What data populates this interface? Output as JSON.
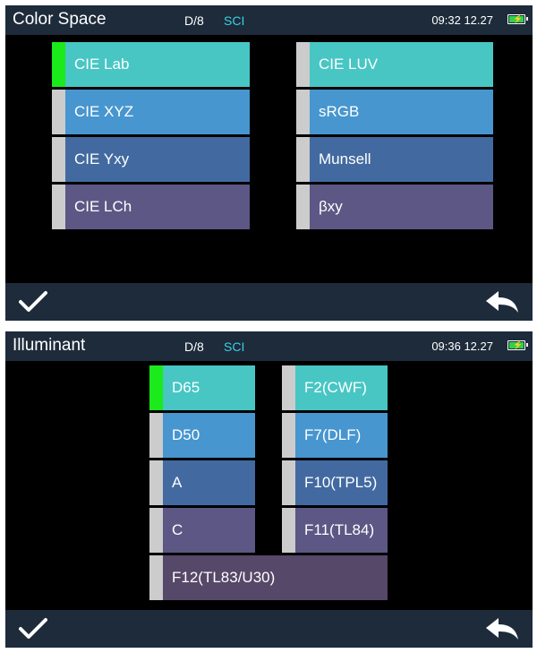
{
  "screens": [
    {
      "title": "Color Space",
      "mode": "D/8",
      "mode2": "SCI",
      "time": "09:32 12.27",
      "options": [
        "CIE Lab",
        "CIE XYZ",
        "CIE Yxy",
        "CIE LCh",
        "CIE LUV",
        "sRGB",
        "Munsell",
        "βxy"
      ],
      "selected": "CIE Lab"
    },
    {
      "title": "Illuminant",
      "mode": "D/8",
      "mode2": "SCI",
      "time": "09:36 12.27",
      "options": [
        "D65",
        "D50",
        "A",
        "C",
        "F2(CWF)",
        "F7(DLF)",
        "F10(TPL5)",
        "F11(TL84)",
        "F12(TL83/U30)"
      ],
      "selected": "D65"
    }
  ],
  "colors": {
    "status_bar": "#1d2b3b",
    "screen_bg": "#000000",
    "row1": "#47c6c4",
    "row2": "#4796cf",
    "row3": "#426aa0",
    "row4": "#5c5784",
    "row5": "#564868",
    "selected_indicator": "#1bea1b",
    "unselected_indicator": "#cccccc",
    "sci_text": "#3ecfe3",
    "battery_fill": "#2fd14a"
  },
  "icons": {
    "confirm": "checkmark-icon",
    "back": "back-arrow-icon",
    "battery": "battery-charging-icon"
  }
}
